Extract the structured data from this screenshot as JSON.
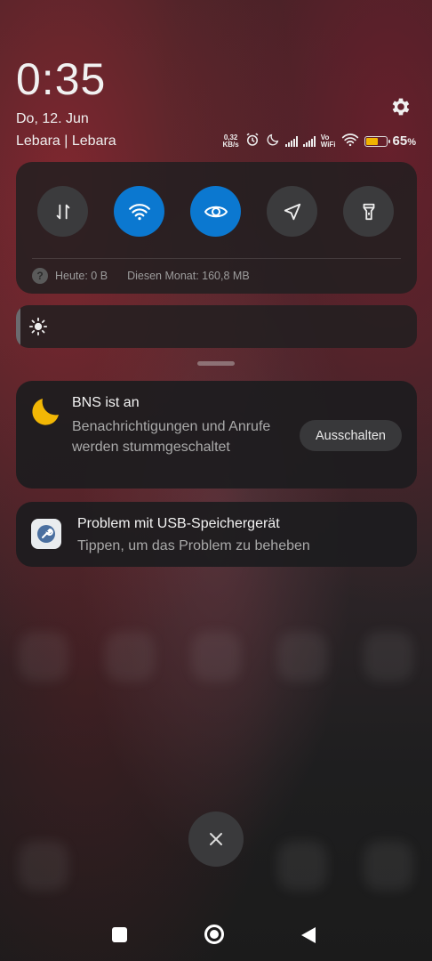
{
  "lockscreen": {
    "time": "0:35",
    "date": "Do, 12. Jun",
    "carrier": "Lebara | Lebara"
  },
  "status_bar": {
    "speed_value": "0,32",
    "speed_unit": "KB/s",
    "vowifi_top": "Vo",
    "vowifi_bottom": "WiFi",
    "battery_percent": "65",
    "battery_percent_suffix": "%",
    "battery_level": 0.65,
    "battery_color": "#f0b400",
    "icons": [
      "alarm-icon",
      "moon-icon",
      "signal-icon",
      "signal-icon",
      "vowifi-icon",
      "wifi-icon",
      "battery-icon"
    ]
  },
  "quick_settings": {
    "accent_color": "#0b78d0",
    "toggles": [
      {
        "name": "mobile-data",
        "icon": "data-arrows-icon",
        "active": false
      },
      {
        "name": "wifi",
        "icon": "wifi-icon",
        "active": true
      },
      {
        "name": "reading-mode",
        "icon": "eye-icon",
        "active": true
      },
      {
        "name": "location",
        "icon": "location-arrow-icon",
        "active": false
      },
      {
        "name": "flashlight",
        "icon": "flashlight-icon",
        "active": false
      }
    ],
    "data_today": "Heute: 0 B",
    "data_month": "Diesen Monat: 160,8 MB",
    "help_glyph": "?"
  },
  "brightness": {
    "level": 0.01,
    "icon": "sun-icon"
  },
  "notifications": [
    {
      "icon": "moon-icon",
      "title": "BNS ist an",
      "body": "Benachrichtigungen und Anrufe werden stummgeschaltet",
      "action": "Ausschalten"
    },
    {
      "icon": "wrench-icon",
      "title": "Problem mit USB-Speichergerät",
      "body": "Tippen, um das Problem zu beheben"
    }
  ],
  "dismiss": {
    "icon": "close-icon"
  },
  "navigation": {
    "icons": [
      "recents-icon",
      "home-icon",
      "back-icon"
    ]
  }
}
